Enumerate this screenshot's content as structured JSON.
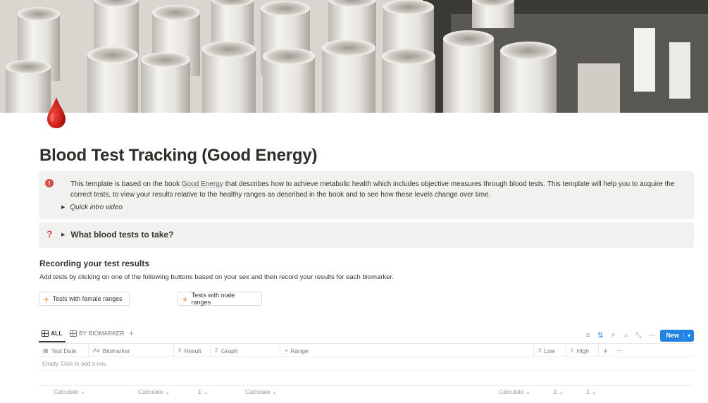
{
  "page": {
    "icon": "blood-drop-icon",
    "title": "Blood Test Tracking (Good Energy)"
  },
  "callout_intro": {
    "icon": "info-icon",
    "text_before_link": "This template is based on the book ",
    "link_text": "Good Energy",
    "text_after_link": " that describes how to achieve metabolic health which includes objective measures through blood tests.  This template will help you to acquire the correct tests, to view your results relative to the healthy ranges as described in the book and to see how these levels change over time.",
    "toggle_label": "Quick intro video"
  },
  "callout_tests": {
    "icon": "question-icon",
    "glyph": "?",
    "toggle_label": "What blood tests to take?"
  },
  "section": {
    "heading": "Recording your test results",
    "description": "Add tests by clicking on one of the following buttons based on your sex and then record your results for each biomarker."
  },
  "buttons": {
    "female": "Tests with female ranges",
    "male": "Tests with male ranges"
  },
  "views": {
    "tabs": [
      {
        "label": "ALL",
        "active": true
      },
      {
        "label": "BY BIOMARKER",
        "active": false
      }
    ],
    "new_label": "New"
  },
  "table": {
    "columns": [
      {
        "label": "Test Date",
        "icon": "calendar-icon"
      },
      {
        "label": "Biomarker",
        "icon": "text-icon",
        "glyph": "Aa"
      },
      {
        "label": "Result",
        "icon": "number-icon",
        "glyph": "#"
      },
      {
        "label": "Graph",
        "icon": "formula-icon",
        "glyph": "Σ"
      },
      {
        "label": "Range",
        "icon": "list-icon",
        "glyph": "≡"
      },
      {
        "label": "Low",
        "icon": "number-icon",
        "glyph": "#"
      },
      {
        "label": "High",
        "icon": "number-icon",
        "glyph": "#"
      }
    ],
    "empty_text": "Empty. Click to add a row.",
    "calc_label": "Calculate",
    "sigma": "Σ"
  },
  "colors": {
    "accent_red": "#d44c47",
    "accent_orange": "#d9730d",
    "new_button_blue": "#2383e2",
    "callout_bg": "#f1f1ef"
  }
}
